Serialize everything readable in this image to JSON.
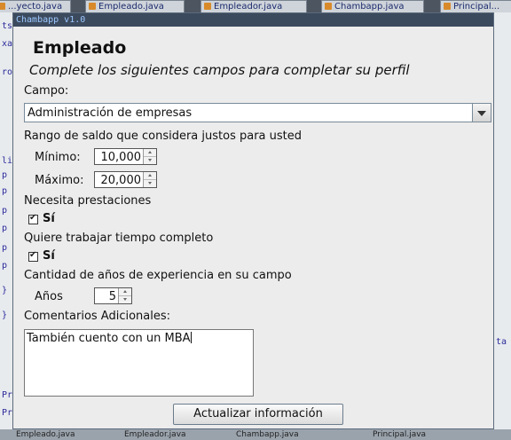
{
  "ide": {
    "tabs": [
      "...yecto.java",
      "Empleado.java",
      "Empleador.java",
      "Chambapp.java",
      "Principal..."
    ],
    "left_fragments": [
      "ts",
      "xa",
      "ro",
      "li",
      "p",
      "p",
      "p",
      "p",
      "p",
      "p",
      "}",
      "}",
      "Pro",
      "Pro"
    ],
    "right_fragments": [
      "ta"
    ],
    "bottom_fragments": [
      "Empleado.java",
      "Empleador.java",
      "Chambapp.java",
      "Principal.java"
    ]
  },
  "dialog": {
    "window_title": "Chambapp v1.0",
    "heading": "Empleado",
    "subtitle": "Complete los siguientes campos para completar su perfil",
    "campo": {
      "label": "Campo:",
      "selected": "Administración de empresas"
    },
    "salary": {
      "label": "Rango de saldo que considera justos para usted",
      "min_label": "Mínimo:",
      "min_value": "10,000",
      "max_label": "Máximo:",
      "max_value": "20,000"
    },
    "benefits": {
      "label": "Necesita prestaciones",
      "checkbox_label": "Sí",
      "checked": true
    },
    "fulltime": {
      "label": "Quiere trabajar tiempo completo",
      "checkbox_label": "Sí",
      "checked": true
    },
    "experience": {
      "label": "Cantidad de años de experiencia en su campo",
      "years_label": "Años",
      "years_value": "5"
    },
    "comments": {
      "label": "Comentarios Adicionales:",
      "value": "También cuento con un MBA"
    },
    "submit_label": "Actualizar información"
  }
}
